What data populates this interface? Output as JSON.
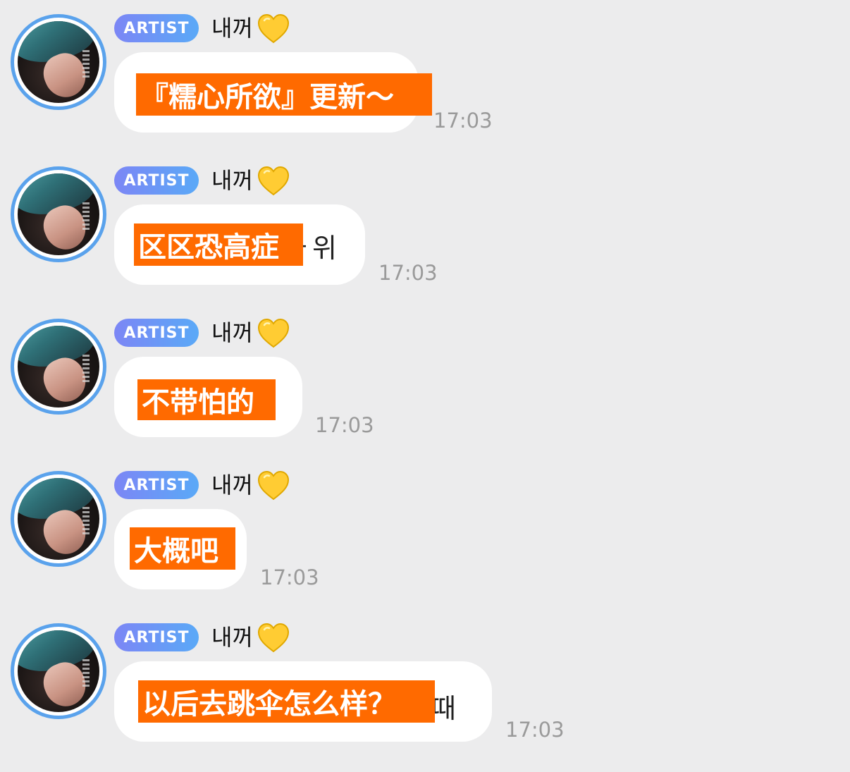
{
  "messages": [
    {
      "badge": "ARTIST",
      "name": "내꺼",
      "caption": "『糯心所欲』更新～",
      "tail": "",
      "time": "17:03"
    },
    {
      "badge": "ARTIST",
      "name": "내꺼",
      "caption": "区区恐高症",
      "tail": "ㅏ위",
      "time": "17:03"
    },
    {
      "badge": "ARTIST",
      "name": "내꺼",
      "caption": "不带怕的",
      "tail": "",
      "time": "17:03"
    },
    {
      "badge": "ARTIST",
      "name": "내꺼",
      "caption": "大概吧",
      "tail": "",
      "time": "17:03"
    },
    {
      "badge": "ARTIST",
      "name": "내꺼",
      "caption": "以后去跳伞怎么样？",
      "tail": "때",
      "time": "17:03"
    }
  ],
  "icons": {
    "avatar": "artist-avatar-photo",
    "heart": "yellow-heart-icon"
  },
  "colors": {
    "badge_start": "#7c86f5",
    "badge_end": "#5aa9f7",
    "caption_bg": "#ff6a00",
    "avatar_ring": "#5aa2ec",
    "background": "#ececed"
  }
}
